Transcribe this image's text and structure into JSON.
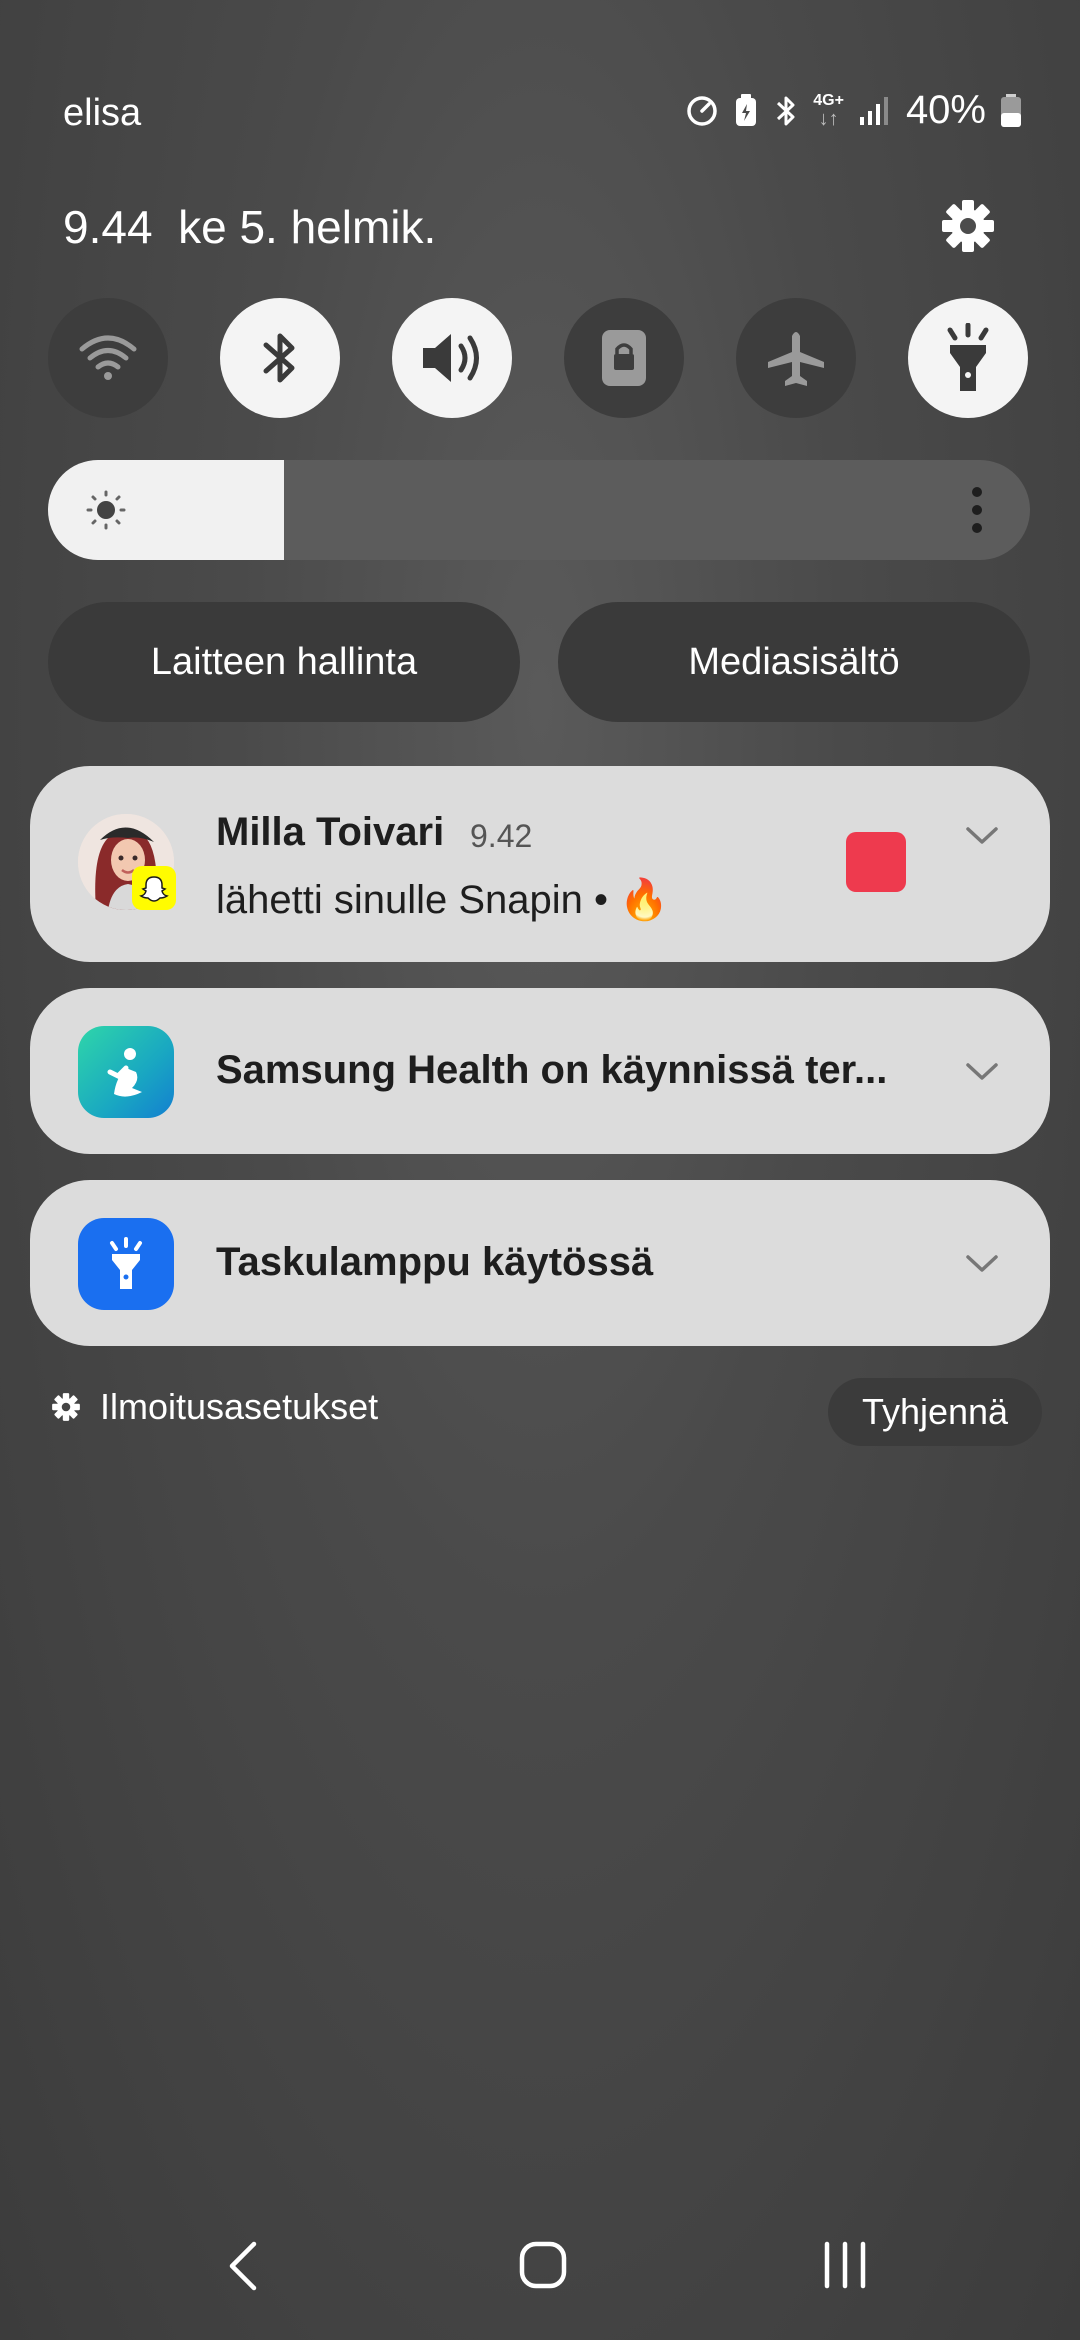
{
  "status_bar": {
    "carrier": "elisa",
    "network": "4G+",
    "battery": "40%",
    "icons": [
      "data-saver-icon",
      "battery-saver-icon",
      "bluetooth-icon",
      "network-4g-icon",
      "signal-icon",
      "battery-icon"
    ]
  },
  "header": {
    "time": "9.44",
    "date": "ke 5. helmik."
  },
  "quick_settings": [
    {
      "id": "wifi",
      "icon": "wifi-icon",
      "active": false
    },
    {
      "id": "bluetooth",
      "icon": "bluetooth-icon",
      "active": true
    },
    {
      "id": "sound",
      "icon": "speaker-icon",
      "active": true
    },
    {
      "id": "rotation-lock",
      "icon": "lock-icon",
      "active": false
    },
    {
      "id": "airplane",
      "icon": "airplane-icon",
      "active": false
    },
    {
      "id": "flashlight",
      "icon": "flashlight-icon",
      "active": true
    }
  ],
  "brightness": {
    "level": 0.24
  },
  "pills": {
    "device_control": "Laitteen hallinta",
    "media_output": "Mediasisältö"
  },
  "notifications": [
    {
      "app": "Snapchat",
      "sender": "Milla Toivari",
      "time": "9.42",
      "message": "lähetti sinulle Snapin • 🔥",
      "accent_color": "#ee3a4e"
    },
    {
      "app": "Samsung Health",
      "title": "Samsung Health on käynnissä ter..."
    },
    {
      "app": "Flashlight",
      "title": "Taskulamppu käytössä"
    }
  ],
  "footer": {
    "settings_label": "Ilmoitusasetukset",
    "clear_label": "Tyhjennä"
  },
  "colors": {
    "snap_yellow": "#fffc00",
    "torch_blue": "#1a6ff0",
    "card_bg": "#dcdcdc"
  }
}
